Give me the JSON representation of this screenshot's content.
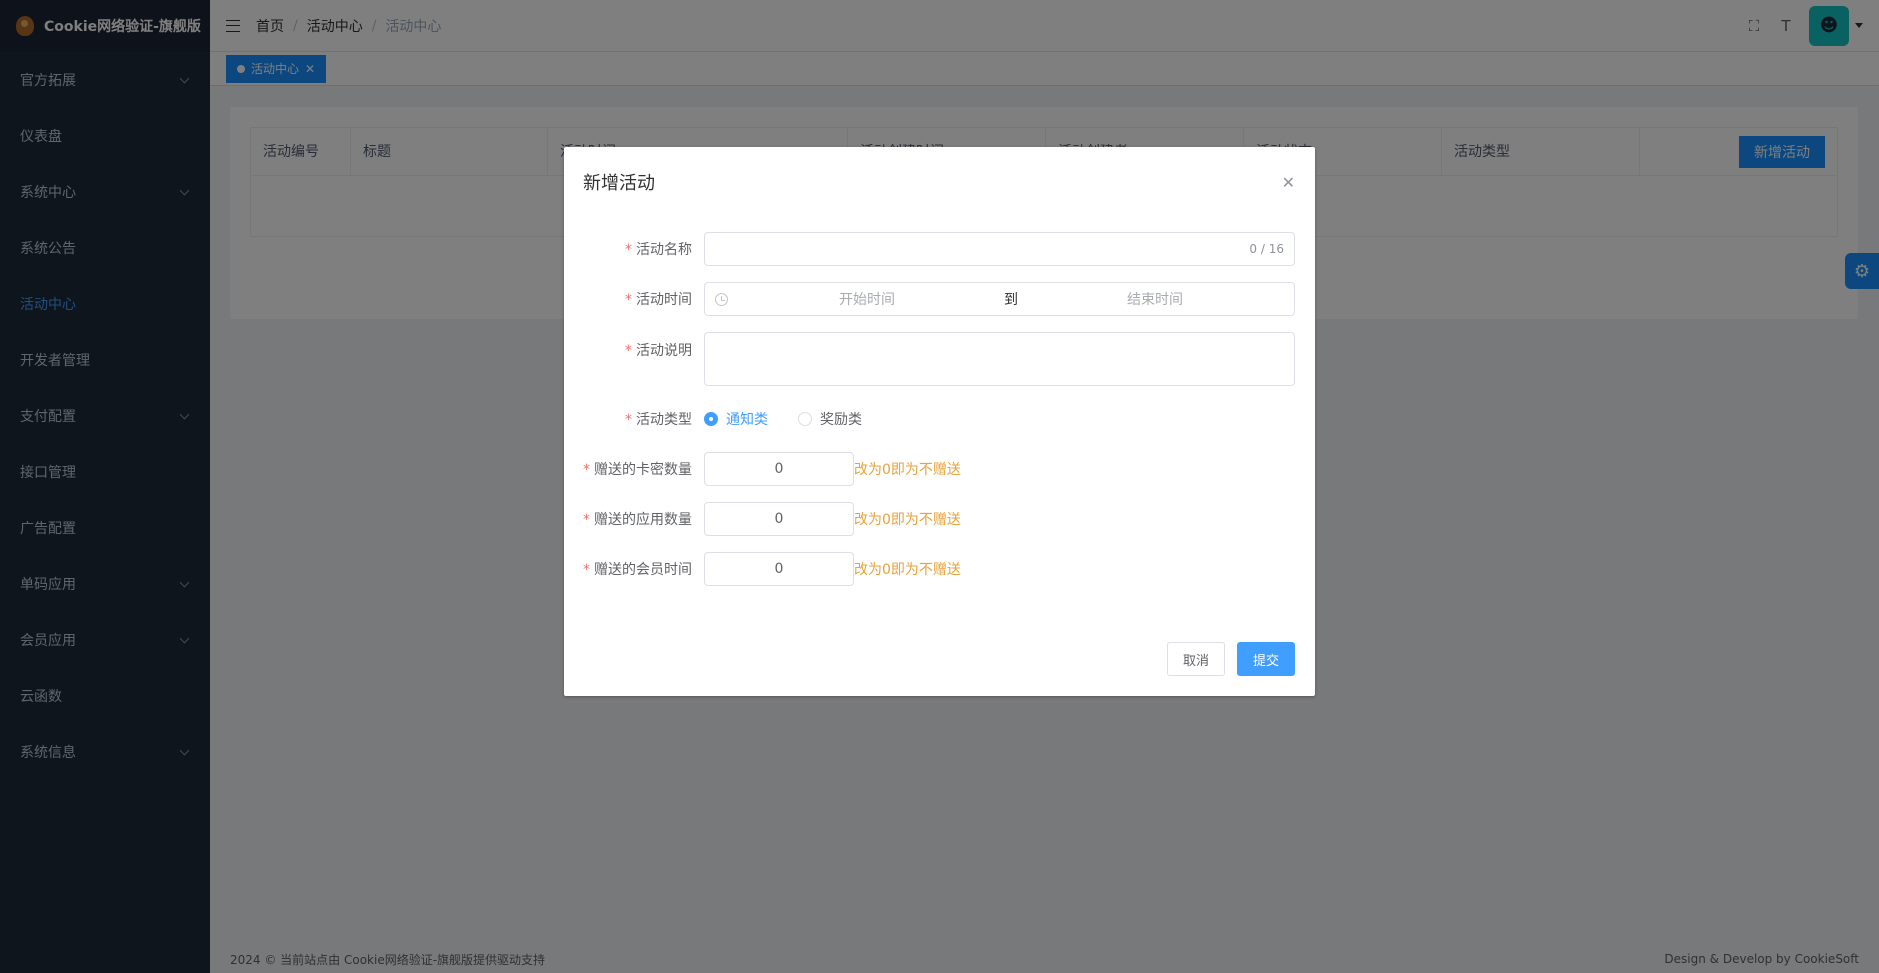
{
  "app": {
    "title": "Cookie网络验证-旗舰版"
  },
  "sidebar": {
    "items": [
      {
        "label": "官方拓展",
        "has_children": true
      },
      {
        "label": "仪表盘",
        "has_children": false
      },
      {
        "label": "系统中心",
        "has_children": true
      },
      {
        "label": "系统公告",
        "has_children": false
      },
      {
        "label": "活动中心",
        "has_children": false,
        "active": true
      },
      {
        "label": "开发者管理",
        "has_children": false
      },
      {
        "label": "支付配置",
        "has_children": true
      },
      {
        "label": "接口管理",
        "has_children": false
      },
      {
        "label": "广告配置",
        "has_children": false
      },
      {
        "label": "单码应用",
        "has_children": true
      },
      {
        "label": "会员应用",
        "has_children": true
      },
      {
        "label": "云函数",
        "has_children": false
      },
      {
        "label": "系统信息",
        "has_children": true
      }
    ]
  },
  "breadcrumb": {
    "items": [
      "首页",
      "活动中心",
      "活动中心"
    ]
  },
  "tags": {
    "active": "活动中心"
  },
  "table": {
    "headers": [
      "活动编号",
      "标题",
      "活动时间",
      "活动创建时间",
      "活动创建者",
      "活动状态",
      "活动类型"
    ],
    "add_button": "新增活动"
  },
  "footer": {
    "left": "2024 © 当前站点由 Cookie网络验证-旗舰版提供驱动支持",
    "right": "Design & Develop by CookieSoft"
  },
  "dialog": {
    "title": "新增活动",
    "name": {
      "label": "活动名称",
      "value": "",
      "count": "0 / 16"
    },
    "time": {
      "label": "活动时间",
      "start_placeholder": "开始时间",
      "separator": "到",
      "end_placeholder": "结束时间"
    },
    "desc": {
      "label": "活动说明",
      "value": ""
    },
    "type": {
      "label": "活动类型",
      "options": [
        "通知类",
        "奖励类"
      ],
      "selected": "通知类"
    },
    "card_count": {
      "label": "赠送的卡密数量",
      "value": "0",
      "hint": "改为0即为不赠送"
    },
    "app_count": {
      "label": "赠送的应用数量",
      "value": "0",
      "hint": "改为0即为不赠送"
    },
    "vip_time": {
      "label": "赠送的会员时间",
      "value": "0",
      "hint": "改为0即为不赠送"
    },
    "cancel": "取消",
    "submit": "提交"
  },
  "colors": {
    "primary": "#409eff",
    "sidebar": "#1f2a3b",
    "warning": "#e6a23c",
    "danger": "#f56c6c"
  }
}
